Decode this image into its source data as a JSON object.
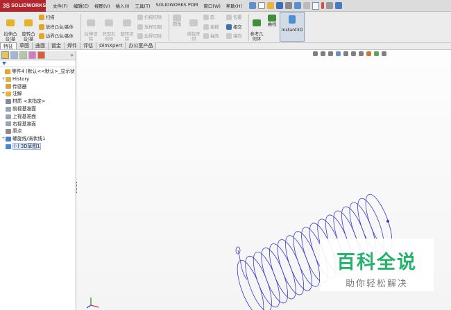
{
  "app": {
    "logo_ds": "3S",
    "logo_text": "SOLIDWORKS"
  },
  "menu": [
    "文件(F)",
    "编辑(E)",
    "视图(V)",
    "插入(I)",
    "工具(T)",
    "SOLIDWORKS PDM",
    "窗口(W)",
    "帮助(H)"
  ],
  "toolbar": {
    "extrude_boss": "拉伸凸\n台/基\n体",
    "revolve_boss": "旋转凸\n台/基\n体",
    "sweep": "扫描",
    "loft": "放样凸台/基体",
    "boundary_boss": "边界凸台/基体",
    "extrude_cut": "拉伸切\n除",
    "hole_wizard": "异型孔\n向导",
    "revolve_cut": "旋转切\n除",
    "sweep_cut": "扫描切除",
    "loft_cut": "放样切割",
    "boundary_cut": "边界切除",
    "fillet": "圆角",
    "linear_pattern": "线性阵\n列",
    "rib": "筋",
    "draft": "拔模",
    "shell": "抽壳",
    "wrap": "包覆",
    "intersect": "相交",
    "mirror": "镜向",
    "ref_geometry": "参考几\n何体",
    "curves": "曲线",
    "instant3d": "Instant3D"
  },
  "tabs": [
    "特征",
    "草图",
    "曲面",
    "钣金",
    "焊件",
    "评估",
    "DimXpert",
    "办公室产品"
  ],
  "active_tab": "特征",
  "tree": [
    {
      "label": "零件4 (默认<<默认>_显示状",
      "icon": "part-icon",
      "expand": "",
      "indent": 0
    },
    {
      "label": "History",
      "icon": "history-icon",
      "expand": "+",
      "indent": 1
    },
    {
      "label": "传感器",
      "icon": "sensor-icon",
      "expand": "",
      "indent": 1
    },
    {
      "label": "注解",
      "icon": "annotation-icon",
      "expand": "+",
      "indent": 1
    },
    {
      "label": "材质 <未指定>",
      "icon": "material-icon",
      "expand": "",
      "indent": 1
    },
    {
      "label": "前视基准面",
      "icon": "plane-icon",
      "expand": "",
      "indent": 1
    },
    {
      "label": "上视基准面",
      "icon": "plane-icon",
      "expand": "",
      "indent": 1
    },
    {
      "label": "右视基准面",
      "icon": "plane-icon",
      "expand": "",
      "indent": 1
    },
    {
      "label": "原点",
      "icon": "origin-icon",
      "expand": "",
      "indent": 1
    },
    {
      "label": "螺旋线/涡状线1",
      "icon": "helix-icon",
      "expand": "+",
      "indent": 1
    },
    {
      "label": "(-) 3D草图1",
      "icon": "sketch3d-icon",
      "expand": "",
      "indent": 1,
      "selected": true
    }
  ],
  "expand_arrow": "»",
  "watermark": {
    "title": "百科全说",
    "subtitle": "助你轻松解决"
  },
  "colors": {
    "brand": "#b3262b",
    "helix": "#3a3acd",
    "watermark": "#25b36b"
  }
}
